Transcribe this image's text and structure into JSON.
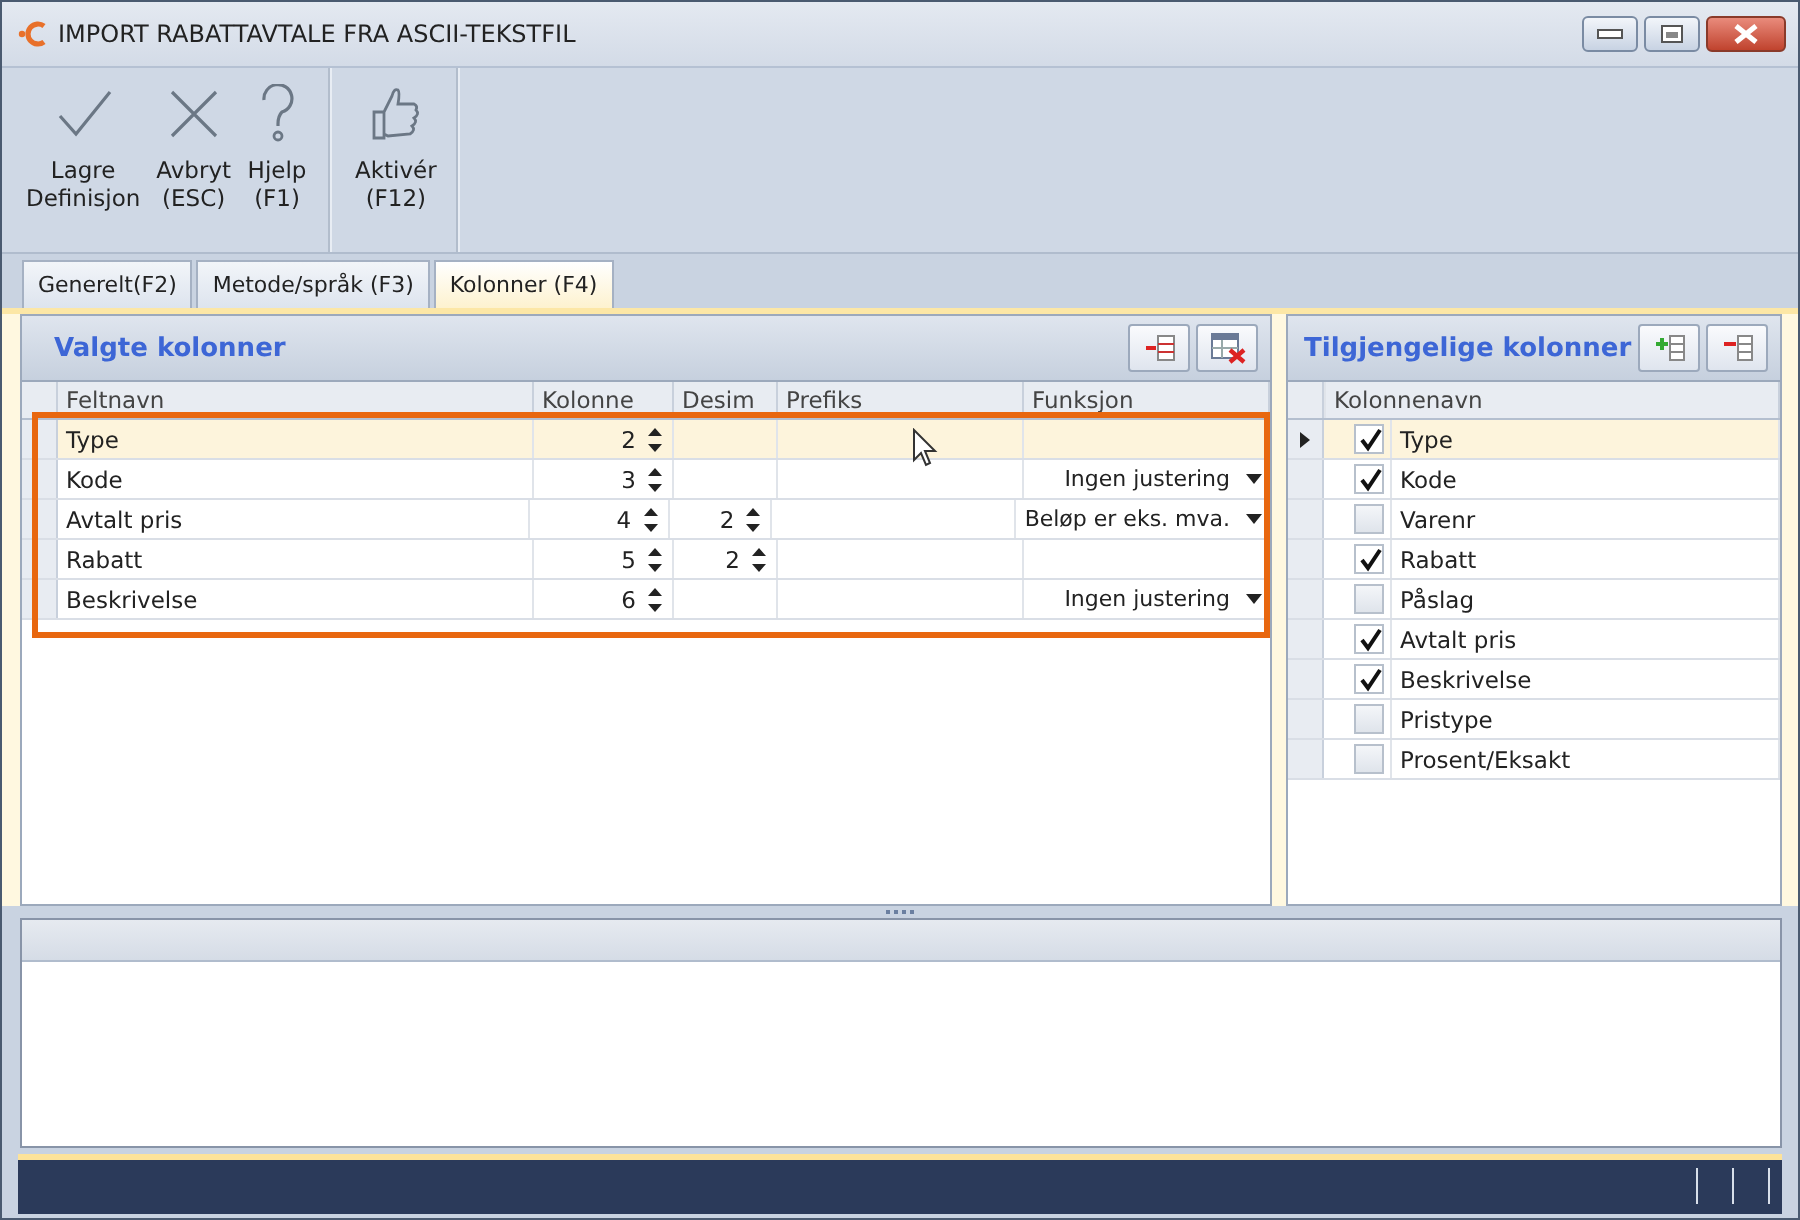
{
  "window": {
    "title": "IMPORT RABATTAVTALE FRA ASCII-TEKSTFIL"
  },
  "toolbar": [
    {
      "kind": "check",
      "label": "Lagre",
      "sub": "Definisjon"
    },
    {
      "kind": "cross",
      "label": "Avbryt",
      "sub": "(ESC)"
    },
    {
      "kind": "help",
      "label": "Hjelp",
      "sub": "(F1)"
    },
    {
      "kind": "thumb",
      "label": "Aktivér",
      "sub": "(F12)"
    }
  ],
  "tabs": [
    {
      "label": "Generelt(F2)",
      "selected": false
    },
    {
      "label": "Metode/språk (F3)",
      "selected": false
    },
    {
      "label": "Kolonner (F4)",
      "selected": true
    }
  ],
  "selected_columns": {
    "title": "Valgte kolonner",
    "columns": [
      "Feltnavn",
      "Kolonne",
      "Desim",
      "Prefiks",
      "Funksjon"
    ],
    "rows": [
      {
        "name": "Type",
        "kolonne": "2",
        "desim": "",
        "prefiks": "",
        "funksjon": "",
        "selected": true
      },
      {
        "name": "Kode",
        "kolonne": "3",
        "desim": "",
        "prefiks": "",
        "funksjon": "Ingen justering",
        "selected": false
      },
      {
        "name": "Avtalt pris",
        "kolonne": "4",
        "desim": "2",
        "prefiks": "",
        "funksjon": "Beløp er eks. mva.",
        "selected": false
      },
      {
        "name": "Rabatt",
        "kolonne": "5",
        "desim": "2",
        "prefiks": "",
        "funksjon": "",
        "selected": false
      },
      {
        "name": "Beskrivelse",
        "kolonne": "6",
        "desim": "",
        "prefiks": "",
        "funksjon": "Ingen justering",
        "selected": false
      }
    ]
  },
  "available_columns": {
    "title": "Tilgjengelige kolonner",
    "column": "Kolonnenavn",
    "rows": [
      {
        "name": "Type",
        "checked": true,
        "selected": true
      },
      {
        "name": "Kode",
        "checked": true,
        "selected": false
      },
      {
        "name": "Varenr",
        "checked": false,
        "selected": false
      },
      {
        "name": "Rabatt",
        "checked": true,
        "selected": false
      },
      {
        "name": "Påslag",
        "checked": false,
        "selected": false
      },
      {
        "name": "Avtalt pris",
        "checked": true,
        "selected": false
      },
      {
        "name": "Beskrivelse",
        "checked": true,
        "selected": false
      },
      {
        "name": "Pristype",
        "checked": false,
        "selected": false
      },
      {
        "name": "Prosent/Eksakt",
        "checked": false,
        "selected": false
      }
    ]
  }
}
